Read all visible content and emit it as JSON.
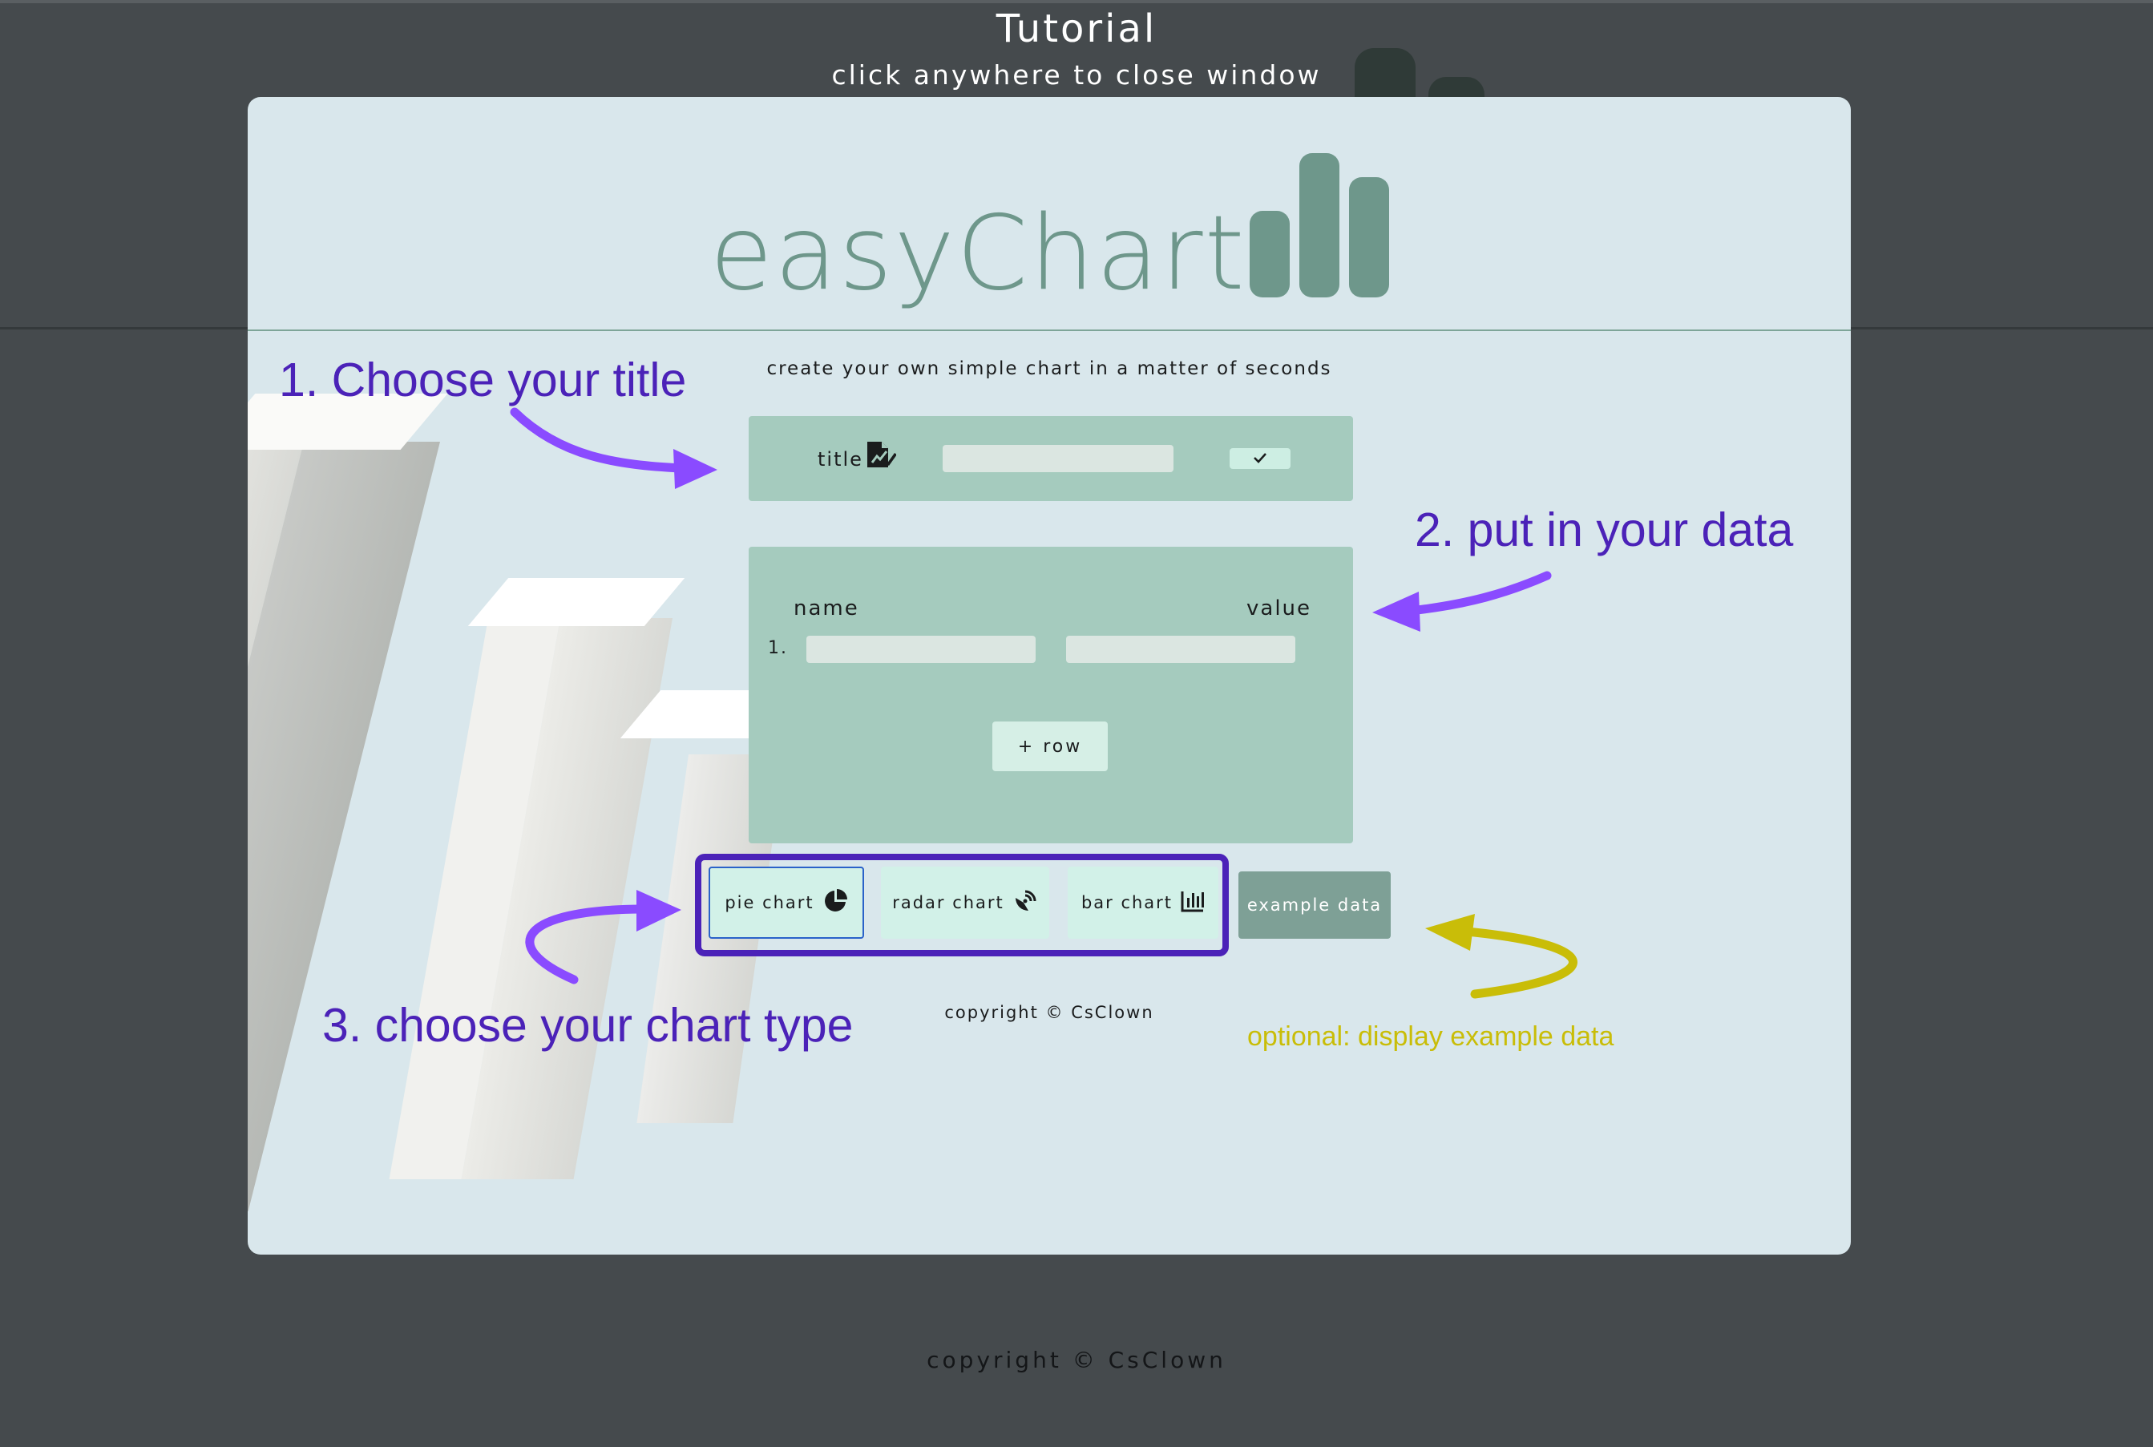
{
  "overlay": {
    "title": "Tutorial",
    "subtitle": "click anywhere to close window",
    "copyright": "copyright © CsClown"
  },
  "app": {
    "logo_text": "easyChart",
    "tagline": "create your own simple chart in a matter of seconds",
    "title_section": {
      "label": "title",
      "title_value": "",
      "confirm_icon": "checkmark-icon",
      "title_icon": "edit-document-icon"
    },
    "data_section": {
      "column_name": "name",
      "column_value": "value",
      "rows": [
        {
          "index": "1.",
          "name": "",
          "value": ""
        }
      ],
      "add_row_label": "+ row"
    },
    "chart_types": [
      {
        "label": "pie chart",
        "icon": "pie-chart-icon",
        "selected": true
      },
      {
        "label": "radar chart",
        "icon": "radar-chart-icon",
        "selected": false
      },
      {
        "label": "bar chart",
        "icon": "bar-chart-icon",
        "selected": false
      }
    ],
    "example_label": "example data",
    "copyright": "copyright © CsClown"
  },
  "annotations": {
    "step1": "1. Choose your title",
    "step2": "2. put in your data",
    "step3": "3. choose your chart type",
    "optional": "optional: display example data"
  },
  "colors": {
    "annotation_purple": "#4b22b8",
    "arrow_purple": "#8a4bff",
    "annotation_yellow": "#c9bd08",
    "brand_green": "#6e978b",
    "card_green": "#a5cbbe"
  }
}
